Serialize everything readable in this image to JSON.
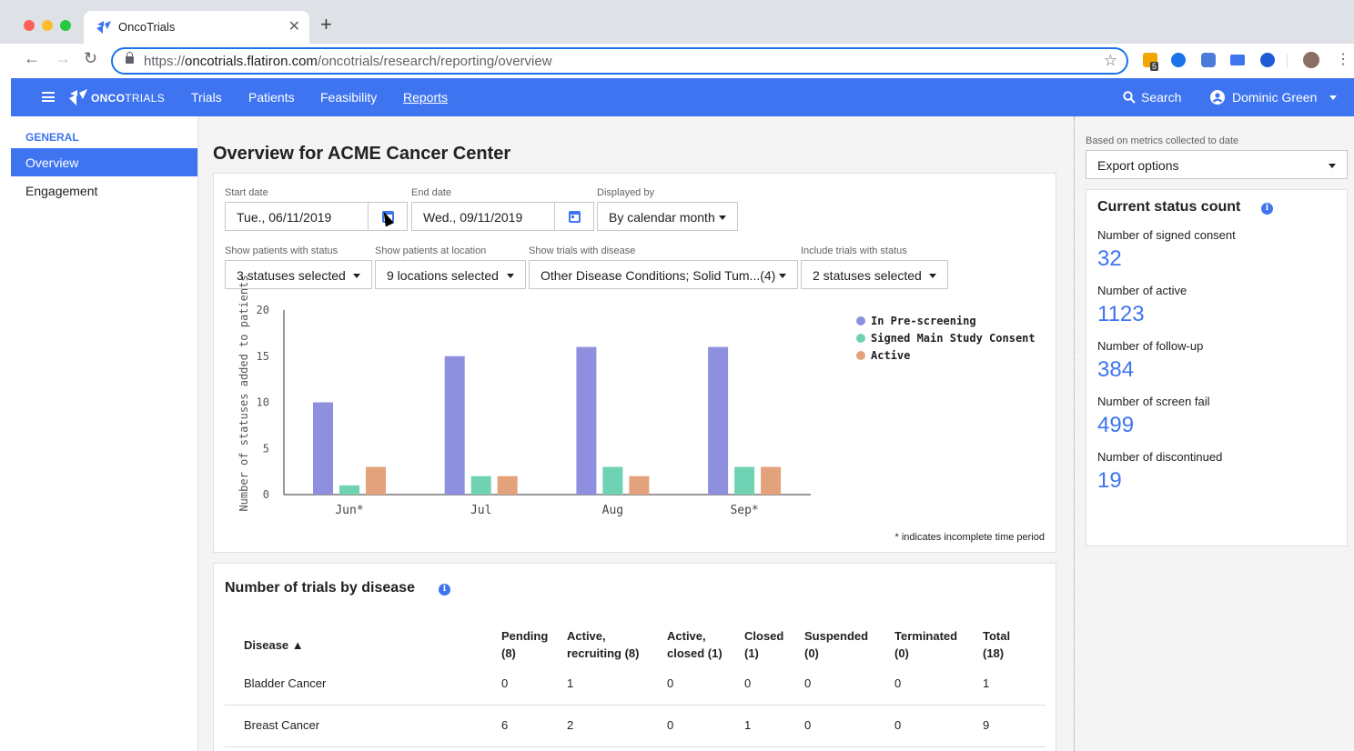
{
  "browser": {
    "tab_title": "OncoTrials",
    "tab_close": "✕",
    "new_tab": "+",
    "url_scheme": "https://",
    "url_host": "oncotrials.flatiron.com",
    "url_path": "/oncotrials/research/reporting/overview",
    "ext_badge": "5"
  },
  "appbar": {
    "logo_bold": "ONCO",
    "logo_light": "TRIALS",
    "nav": [
      "Trials",
      "Patients",
      "Feasibility",
      "Reports"
    ],
    "active_nav": "Reports",
    "search_label": "Search",
    "user_name": "Dominic Green"
  },
  "sidebar": {
    "heading": "GENERAL",
    "items": [
      "Overview",
      "Engagement"
    ],
    "selected": "Overview"
  },
  "main": {
    "title": "Overview for ACME Cancer Center",
    "filters": {
      "start_date_label": "Start date",
      "start_date_value": "Tue., 06/11/2019",
      "end_date_label": "End date",
      "end_date_value": "Wed., 09/11/2019",
      "displayed_by_label": "Displayed by",
      "displayed_by_value": "By calendar month",
      "status_label": "Show patients with status",
      "status_value": "3 statuses selected",
      "location_label": "Show patients at location",
      "location_value": "9 locations selected",
      "disease_label": "Show trials with disease",
      "disease_value": "Other Disease Conditions; Solid Tum...(4)",
      "trial_status_label": "Include trials with status",
      "trial_status_value": "2 statuses selected"
    },
    "footnote": "* indicates incomplete time period"
  },
  "chart_data": {
    "type": "bar",
    "categories": [
      "Jun*",
      "Jul",
      "Aug",
      "Sep*"
    ],
    "series": [
      {
        "name": "In Pre-screening",
        "values": [
          10,
          15,
          16,
          16
        ],
        "color": "#8f8fe0"
      },
      {
        "name": "Signed Main Study Consent",
        "values": [
          1,
          2,
          3,
          3
        ],
        "color": "#6fd2b2"
      },
      {
        "name": "Active",
        "values": [
          3,
          2,
          2,
          3
        ],
        "color": "#e3a27c"
      }
    ],
    "ylabel": "Number of statuses added to patients",
    "xlabel": "",
    "ylim": [
      0,
      20
    ],
    "yticks": [
      "0",
      "5",
      "10",
      "15",
      "20"
    ],
    "legend": "top-right",
    "grid": false
  },
  "trials_table": {
    "title": "Number of trials by disease",
    "columns": [
      {
        "l1": "Disease ▲",
        "l2": ""
      },
      {
        "l1": "Pending",
        "l2": "(8)"
      },
      {
        "l1": "Active,",
        "l2": "recruiting (8)"
      },
      {
        "l1": "Active,",
        "l2": "closed (1)"
      },
      {
        "l1": "Closed",
        "l2": "(1)"
      },
      {
        "l1": "Suspended",
        "l2": "(0)"
      },
      {
        "l1": "Terminated",
        "l2": "(0)"
      },
      {
        "l1": "Total",
        "l2": "(18)"
      }
    ],
    "rows": [
      [
        "Bladder Cancer",
        "0",
        "1",
        "0",
        "0",
        "0",
        "0",
        "1"
      ],
      [
        "Breast Cancer",
        "6",
        "2",
        "0",
        "1",
        "0",
        "0",
        "9"
      ]
    ]
  },
  "right_panel": {
    "note": "Based on metrics collected to date",
    "export_label": "Export options",
    "status_title": "Current status count",
    "metrics": [
      {
        "label": "Number of signed consent",
        "value": "32"
      },
      {
        "label": "Number of active",
        "value": "1123"
      },
      {
        "label": "Number of follow-up",
        "value": "384"
      },
      {
        "label": "Number of screen fail",
        "value": "499"
      },
      {
        "label": "Number of discontinued",
        "value": "19"
      }
    ]
  },
  "colors": {
    "brand": "#3e74f0",
    "prescreening": "#8f8fe0",
    "consent": "#6fd2b2",
    "active": "#e3a27c"
  }
}
